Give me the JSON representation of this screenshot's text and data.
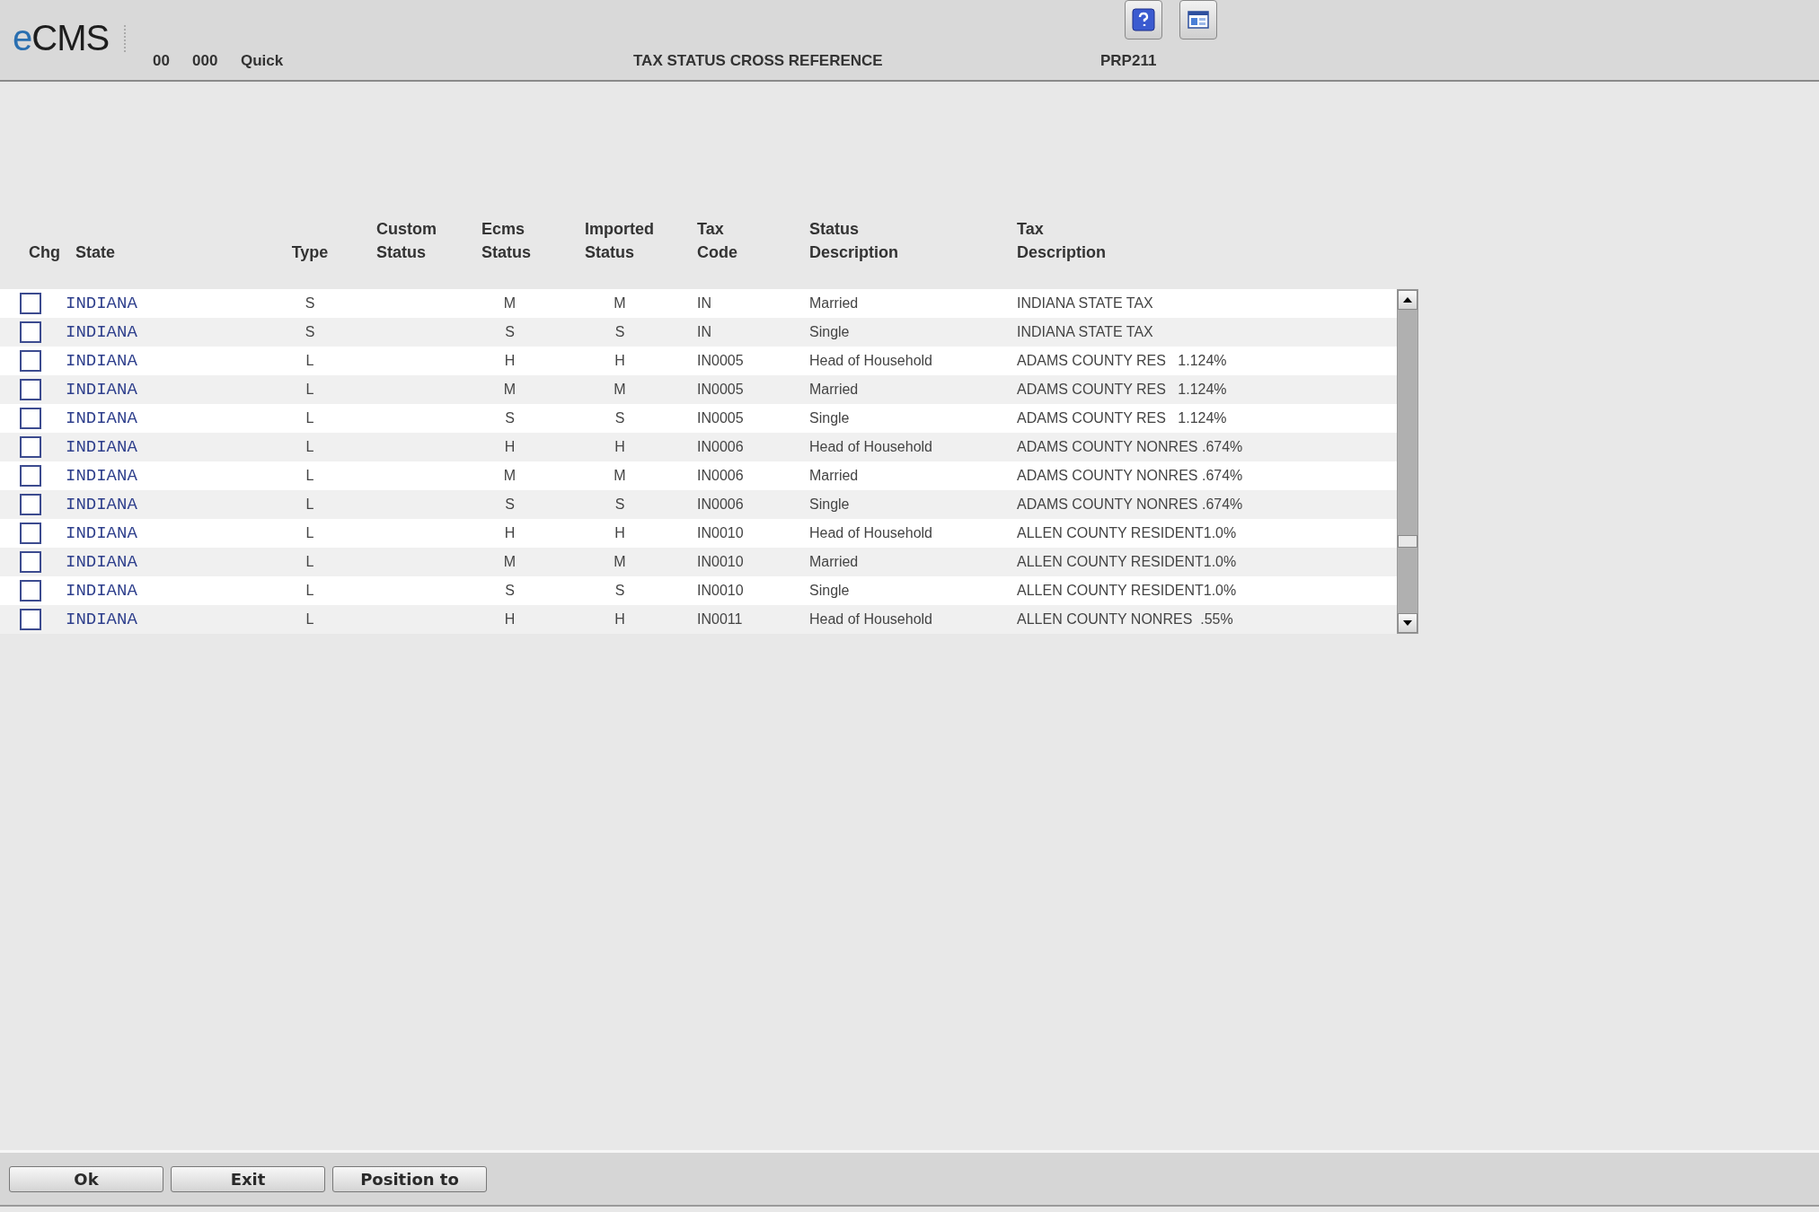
{
  "header": {
    "logo": "eCMS",
    "company": "00",
    "division": "000",
    "mode": "Quick",
    "title": "TAX STATUS CROSS REFERENCE",
    "program": "PRP211"
  },
  "table": {
    "columns": [
      {
        "lines": [
          "Chg"
        ]
      },
      {
        "lines": [
          "State"
        ]
      },
      {
        "lines": [
          "Type"
        ]
      },
      {
        "lines": [
          "Custom",
          "Status"
        ]
      },
      {
        "lines": [
          "Ecms",
          "Status"
        ]
      },
      {
        "lines": [
          "Imported",
          "Status"
        ]
      },
      {
        "lines": [
          "Tax",
          "Code"
        ]
      },
      {
        "lines": [
          "Status",
          "Description"
        ]
      },
      {
        "lines": [
          "Tax",
          "Description"
        ]
      }
    ],
    "rows": [
      {
        "checked": false,
        "state": "INDIANA",
        "type": "S",
        "ecms_status": "M",
        "imported_status": "M",
        "tax_code": "IN",
        "status_description": "Married",
        "tax_description": "INDIANA STATE TAX"
      },
      {
        "checked": false,
        "state": "INDIANA",
        "type": "S",
        "ecms_status": "S",
        "imported_status": "S",
        "tax_code": "IN",
        "status_description": "Single",
        "tax_description": "INDIANA STATE TAX"
      },
      {
        "checked": false,
        "state": "INDIANA",
        "type": "L",
        "ecms_status": "H",
        "imported_status": "H",
        "tax_code": "IN0005",
        "status_description": "Head of Household",
        "tax_description": "ADAMS COUNTY RES   1.124%"
      },
      {
        "checked": false,
        "state": "INDIANA",
        "type": "L",
        "ecms_status": "M",
        "imported_status": "M",
        "tax_code": "IN0005",
        "status_description": "Married",
        "tax_description": "ADAMS COUNTY RES   1.124%"
      },
      {
        "checked": false,
        "state": "INDIANA",
        "type": "L",
        "ecms_status": "S",
        "imported_status": "S",
        "tax_code": "IN0005",
        "status_description": "Single",
        "tax_description": "ADAMS COUNTY RES   1.124%"
      },
      {
        "checked": false,
        "state": "INDIANA",
        "type": "L",
        "ecms_status": "H",
        "imported_status": "H",
        "tax_code": "IN0006",
        "status_description": "Head of Household",
        "tax_description": "ADAMS COUNTY NONRES .674%"
      },
      {
        "checked": false,
        "state": "INDIANA",
        "type": "L",
        "ecms_status": "M",
        "imported_status": "M",
        "tax_code": "IN0006",
        "status_description": "Married",
        "tax_description": "ADAMS COUNTY NONRES .674%"
      },
      {
        "checked": false,
        "state": "INDIANA",
        "type": "L",
        "ecms_status": "S",
        "imported_status": "S",
        "tax_code": "IN0006",
        "status_description": "Single",
        "tax_description": "ADAMS COUNTY NONRES .674%"
      },
      {
        "checked": false,
        "state": "INDIANA",
        "type": "L",
        "ecms_status": "H",
        "imported_status": "H",
        "tax_code": "IN0010",
        "status_description": "Head of Household",
        "tax_description": "ALLEN COUNTY RESIDENT1.0%"
      },
      {
        "checked": false,
        "state": "INDIANA",
        "type": "L",
        "ecms_status": "M",
        "imported_status": "M",
        "tax_code": "IN0010",
        "status_description": "Married",
        "tax_description": "ALLEN COUNTY RESIDENT1.0%"
      },
      {
        "checked": false,
        "state": "INDIANA",
        "type": "L",
        "ecms_status": "S",
        "imported_status": "S",
        "tax_code": "IN0010",
        "status_description": "Single",
        "tax_description": "ALLEN COUNTY RESIDENT1.0%"
      },
      {
        "checked": false,
        "state": "INDIANA",
        "type": "L",
        "ecms_status": "H",
        "imported_status": "H",
        "tax_code": "IN0011",
        "status_description": "Head of Household",
        "tax_description": "ALLEN COUNTY NONRES  .55%"
      }
    ]
  },
  "buttons": [
    "Ok",
    "Exit",
    "Position to"
  ]
}
